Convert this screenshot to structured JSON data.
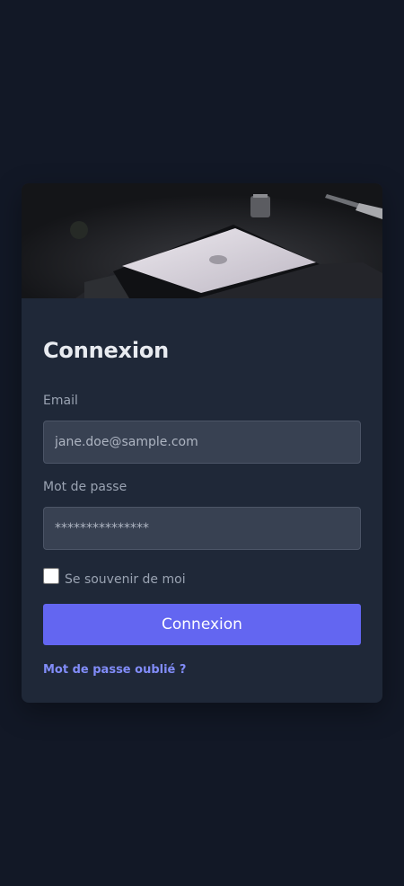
{
  "login": {
    "title": "Connexion",
    "email_label": "Email",
    "email_value": "jane.doe@sample.com",
    "password_label": "Mot de passe",
    "password_value": "***************",
    "remember_label": "Se souvenir de moi",
    "remember_checked": false,
    "submit_label": "Connexion",
    "forgot_label": "Mot de passe oublié ?"
  },
  "colors": {
    "page_background": "#121826",
    "card_background": "#1f2838",
    "input_background": "#384152",
    "accent": "#6366f1",
    "link": "#818cf8"
  },
  "hero_image": {
    "subject": "laptop-on-dark-desk-photo"
  }
}
